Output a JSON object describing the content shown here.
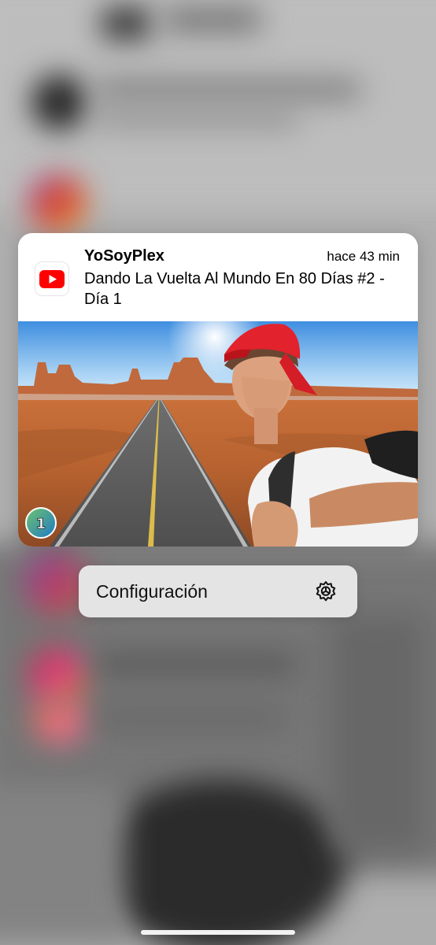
{
  "notification": {
    "app_icon": "youtube-icon",
    "sender": "YoSoyPlex",
    "time": "hace 43 min",
    "message": "Dando La Vuelta Al Mundo En 80 Días #2 - Día 1",
    "thumbnail_badge": "1",
    "brand_color": "#ff0000"
  },
  "context_menu": {
    "items": [
      {
        "label": "Configuración",
        "icon": "gear-icon"
      }
    ]
  }
}
